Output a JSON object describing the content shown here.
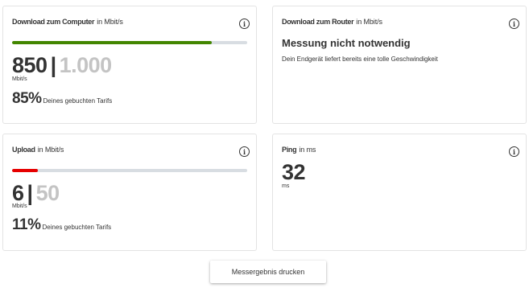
{
  "download_computer": {
    "title_bold": "Download zum Computer",
    "title_unit": "in Mbit/s",
    "progress_percent": 85,
    "measured": "850",
    "separator": "|",
    "booked": "1.000",
    "value_unit": "Mbit/s",
    "percent": "85%",
    "percent_label": "Deines gebuchten Tarifs",
    "bar_color": "#428600"
  },
  "download_router": {
    "title_bold": "Download zum Router",
    "title_unit": "in Mbit/s",
    "headline": "Messung nicht notwendig",
    "subtext": "Dein Endgerät liefert bereits eine tolle Geschwindigkeit"
  },
  "upload": {
    "title_bold": "Upload",
    "title_unit": "in Mbit/s",
    "progress_percent": 11,
    "measured": "6",
    "separator": "|",
    "booked": "50",
    "value_unit": "Mbit/s",
    "percent": "11%",
    "percent_label": "Deines gebuchten Tarifs",
    "bar_color": "#e60000"
  },
  "ping": {
    "title_bold": "Ping",
    "title_unit": "in ms",
    "value": "32",
    "value_unit": "ms"
  },
  "info_icon_glyph": "i",
  "print_button_label": "Messergebnis drucken",
  "colors": {
    "text": "#333333",
    "booked_gray": "#c4c4c4",
    "track": "#d8dde2"
  }
}
